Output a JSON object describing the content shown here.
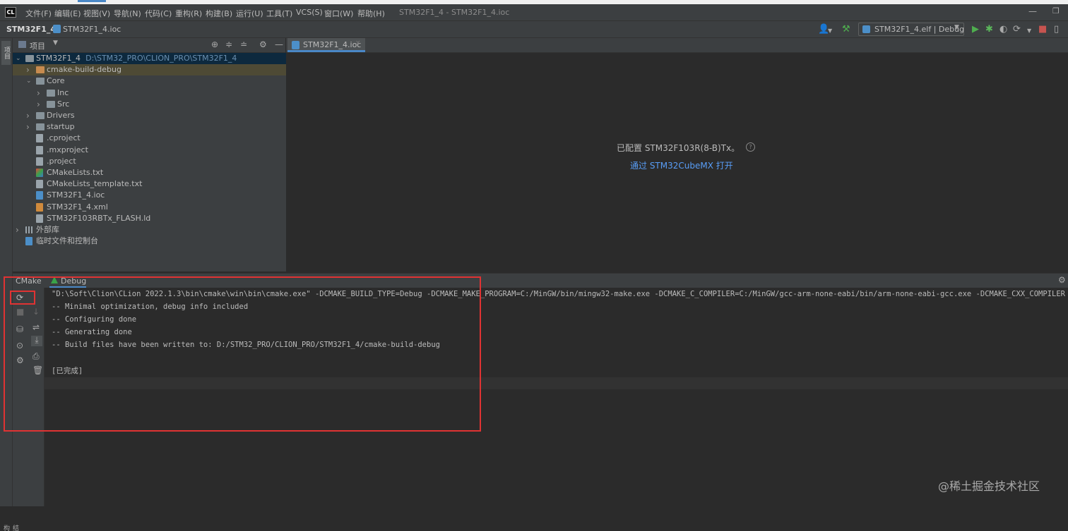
{
  "app": {
    "logo": "CL",
    "window_title": "STM32F1_4 - STM32F1_4.ioc",
    "menu": [
      "文件(F)",
      "编辑(E)",
      "视图(V)",
      "导航(N)",
      "代码(C)",
      "重构(R)",
      "构建(B)",
      "运行(U)",
      "工具(T)",
      "VCS(S)",
      "窗口(W)",
      "帮助(H)"
    ]
  },
  "navbar": {
    "project": "STM32F1_4",
    "file": "STM32F1_4.ioc",
    "run_config": "STM32F1_4.elf | Debug"
  },
  "left_stripe": {
    "project": "项目",
    "structure": "结构"
  },
  "project_panel": {
    "title": "项目",
    "tree": [
      {
        "label": "STM32F1_4",
        "path": "D:\\STM32_PRO\\CLION_PRO\\STM32F1_4",
        "indent": 0,
        "chevron": "open",
        "icon": "folder",
        "state": "selected"
      },
      {
        "label": "cmake-build-debug",
        "indent": 1,
        "chevron": "closed",
        "icon": "folder-orange",
        "state": "highlight"
      },
      {
        "label": "Core",
        "indent": 1,
        "chevron": "open",
        "icon": "folder"
      },
      {
        "label": "Inc",
        "indent": 2,
        "chevron": "closed",
        "icon": "folder"
      },
      {
        "label": "Src",
        "indent": 2,
        "chevron": "closed",
        "icon": "folder"
      },
      {
        "label": "Drivers",
        "indent": 1,
        "chevron": "closed",
        "icon": "folder"
      },
      {
        "label": "startup",
        "indent": 1,
        "chevron": "closed",
        "icon": "folder"
      },
      {
        "label": ".cproject",
        "indent": 1,
        "icon": "file"
      },
      {
        "label": ".mxproject",
        "indent": 1,
        "icon": "file"
      },
      {
        "label": ".project",
        "indent": 1,
        "icon": "file"
      },
      {
        "label": "CMakeLists.txt",
        "indent": 1,
        "icon": "cmake"
      },
      {
        "label": "CMakeLists_template.txt",
        "indent": 1,
        "icon": "file"
      },
      {
        "label": "STM32F1_4.ioc",
        "indent": 1,
        "icon": "ioc"
      },
      {
        "label": "STM32F1_4.xml",
        "indent": 1,
        "icon": "xml"
      },
      {
        "label": "STM32F103RBTx_FLASH.ld",
        "indent": 1,
        "icon": "file"
      },
      {
        "label": "外部库",
        "indent": 0,
        "chevron": "closed",
        "icon": "library"
      },
      {
        "label": "临时文件和控制台",
        "indent": 0,
        "icon": "scratch"
      }
    ]
  },
  "editor": {
    "tab": "STM32F1_4.ioc",
    "message": "已配置 STM32F103R(8-B)Tx。",
    "link": "通过 STM32CubeMX 打开"
  },
  "bottom_panel": {
    "tabs": [
      "CMake",
      "Debug"
    ],
    "active_tab": "Debug",
    "console_lines": [
      "\"D:\\Soft\\Clion\\CLion 2022.1.3\\bin\\cmake\\win\\bin\\cmake.exe\" -DCMAKE_BUILD_TYPE=Debug -DCMAKE_MAKE_PROGRAM=C:/MinGW/bin/mingw32-make.exe -DCMAKE_C_COMPILER=C:/MinGW/gcc-arm-none-eabi/bin/arm-none-eabi-gcc.exe -DCMAKE_CXX_COMPILER",
      "-- Minimal optimization, debug info included",
      "-- Configuring done",
      "-- Generating done",
      "-- Build files have been written to: D:/STM32_PRO/CLION_PRO/STM32F1_4/cmake-build-debug",
      "",
      "[已完成]"
    ]
  },
  "watermark": "@稀土掘金技术社区",
  "icons": {
    "reload": "reload-icon",
    "stop": "stop-icon",
    "settings": "gear-icon",
    "soft_wrap": "soft-wrap-icon",
    "scroll_end": "scroll-to-end-icon",
    "print": "print-icon",
    "trash": "trash-icon"
  },
  "colors": {
    "accent": "#4a88c7",
    "link": "#589df6",
    "annotation": "#e03333",
    "run_green": "#3aa34a"
  }
}
